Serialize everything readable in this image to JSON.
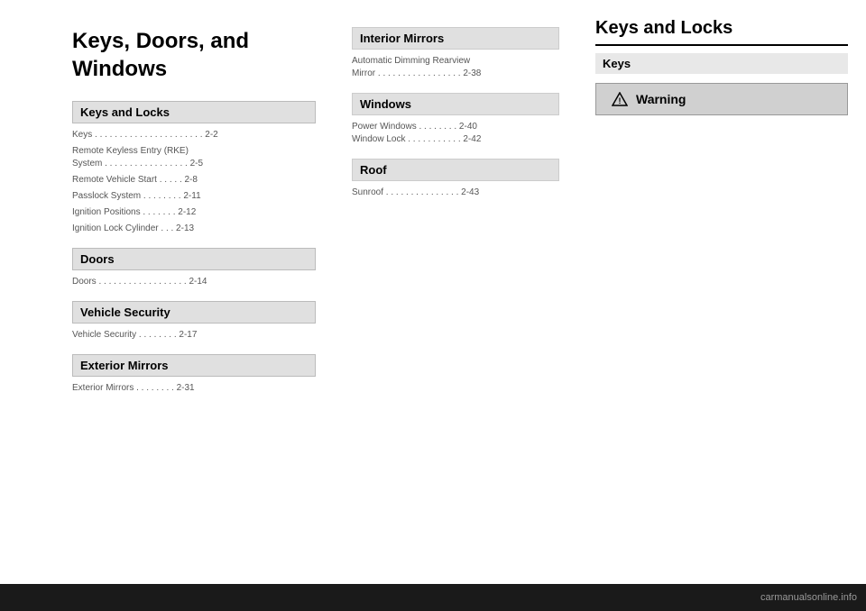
{
  "page": {
    "background": "#1a1a1a"
  },
  "left_column": {
    "chapter_title": "Keys, Doors, and Windows",
    "sections": [
      {
        "id": "keys-and-locks",
        "label": "Keys and Locks",
        "type": "dark-header"
      },
      {
        "id": "text1",
        "content": "Keys . . . . . . . . . . . . . . . . . . . . . . 2-2",
        "type": "text"
      },
      {
        "id": "text2",
        "content": "Remote Keyless Entry (RKE)\nSystem . . . . . . . . . . . . . . . . . 2-5",
        "type": "text"
      },
      {
        "id": "text3",
        "content": "Remote Vehicle Start . . . . . 2-8",
        "type": "text"
      },
      {
        "id": "text4",
        "content": "Passlock System . . . . . . . . 2-11",
        "type": "text"
      },
      {
        "id": "text5",
        "content": "Ignition Positions . . . . . . . 2-12",
        "type": "text"
      },
      {
        "id": "text6",
        "content": "Ignition Lock Cylinder . . . 2-13",
        "type": "text"
      },
      {
        "id": "doors",
        "label": "Doors",
        "type": "dark-header"
      },
      {
        "id": "vehicle-security",
        "label": "Vehicle Security",
        "type": "dark-header"
      },
      {
        "id": "text7",
        "content": "Vehicle Security . . . . . . . . 2-17",
        "type": "text"
      },
      {
        "id": "exterior-mirrors",
        "label": "Exterior Mirrors",
        "type": "dark-header"
      }
    ]
  },
  "middle_column": {
    "sections": [
      {
        "id": "interior-mirrors",
        "label": "Interior Mirrors",
        "type": "header"
      },
      {
        "id": "text-im1",
        "content": "Automatic Dimming Rearview\nMirror . . . . . . . . . . . . . . . . . 2-38",
        "type": "text"
      },
      {
        "id": "windows",
        "label": "Windows",
        "type": "header"
      },
      {
        "id": "text-w1",
        "content": "Power Windows . . . . . . . . 2-40\nWindow Lock . . . . . . . . . . . 2-42",
        "type": "text"
      },
      {
        "id": "roof",
        "label": "Roof",
        "type": "header"
      },
      {
        "id": "text-r1",
        "content": "Sunroof . . . . . . . . . . . . . . . 2-43",
        "type": "text"
      }
    ]
  },
  "right_column": {
    "chapter_title": "Keys and Locks",
    "sub_section": "Keys",
    "warning_label": "Warning"
  },
  "bottom_bar": {
    "logo_text": "carmanualsonline.info"
  }
}
